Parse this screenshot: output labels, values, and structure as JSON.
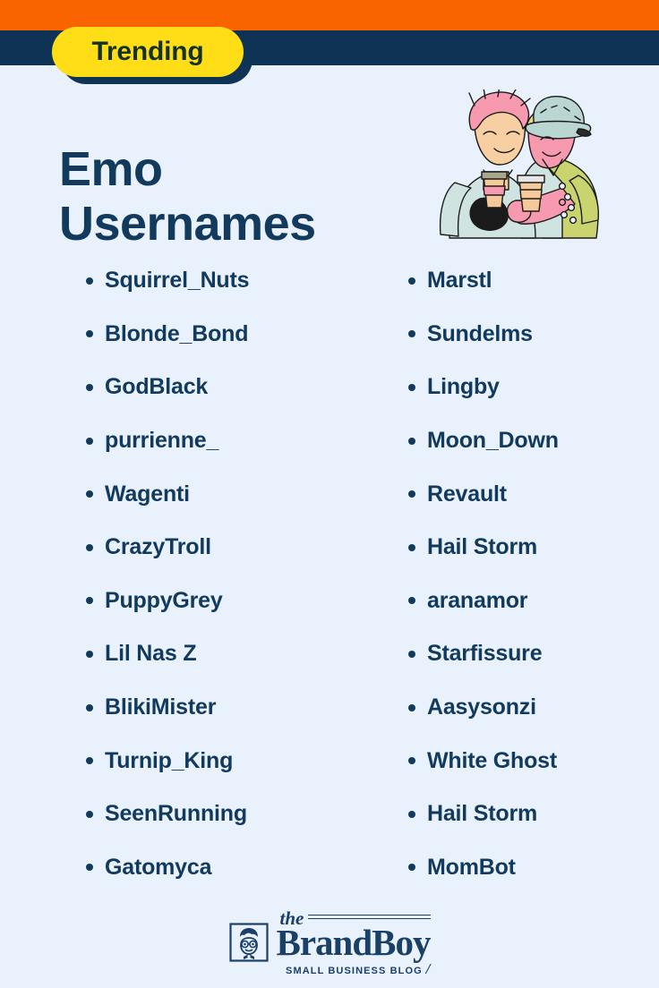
{
  "theme": {
    "background": "#e8f1fc",
    "band_orange": "#fa6400",
    "band_navy": "#0f3354",
    "badge_yellow": "#ffdd17",
    "text_navy": "#123a5c"
  },
  "badge": {
    "label": "Trending"
  },
  "title": "Emo\nUsernames",
  "illustration": {
    "alt": "two people leaning together holding takeaway coffee cups"
  },
  "list": {
    "left_column": [
      {
        "name": "Squirrel_Nuts"
      },
      {
        "name": "Blonde_Bond"
      },
      {
        "name": "GodBlack"
      },
      {
        "name": "purrienne_"
      },
      {
        "name": "Wagenti"
      },
      {
        "name": "CrazyTroll"
      },
      {
        "name": "PuppyGrey"
      },
      {
        "name": "Lil Nas Z"
      },
      {
        "name": "BlikiMister"
      },
      {
        "name": "Turnip_King"
      },
      {
        "name": "SeenRunning"
      },
      {
        "name": "Gatomyca"
      }
    ],
    "right_column": [
      {
        "name": "Marstl"
      },
      {
        "name": "Sundelms"
      },
      {
        "name": "Lingby"
      },
      {
        "name": "Moon_Down"
      },
      {
        "name": "Revault"
      },
      {
        "name": "Hail Storm"
      },
      {
        "name": "aranamor"
      },
      {
        "name": "Starfissure"
      },
      {
        "name": "Aasysonzi"
      },
      {
        "name": "White Ghost"
      },
      {
        "name": "Hail Storm"
      },
      {
        "name": "MomBot"
      }
    ]
  },
  "footer": {
    "the": "the",
    "brand": "BrandBoy",
    "tagline": "SMALL BUSINESS BLOG",
    "slash": "/"
  }
}
